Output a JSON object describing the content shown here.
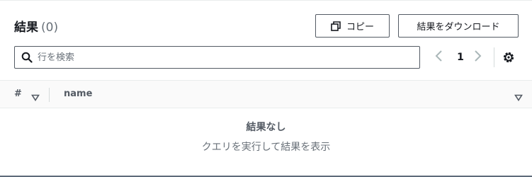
{
  "header": {
    "title": "結果",
    "count": "(0)",
    "copy_label": "コピー",
    "download_label": "結果をダウンロード"
  },
  "search": {
    "placeholder": "行を検索",
    "value": ""
  },
  "pagination": {
    "current_page": "1"
  },
  "table": {
    "columns": [
      "#",
      "name"
    ]
  },
  "empty_state": {
    "title": "結果なし",
    "description": "クエリを実行して結果を表示"
  },
  "icons": {
    "copy": "copy-icon",
    "search": "search-icon",
    "prev": "chevron-left-icon",
    "next": "chevron-right-icon",
    "settings": "gear-icon",
    "sort": "sort-down-icon"
  },
  "colors": {
    "text": "#16191f",
    "muted": "#687078",
    "border": "#545b64",
    "header_bg": "#fafafa"
  }
}
